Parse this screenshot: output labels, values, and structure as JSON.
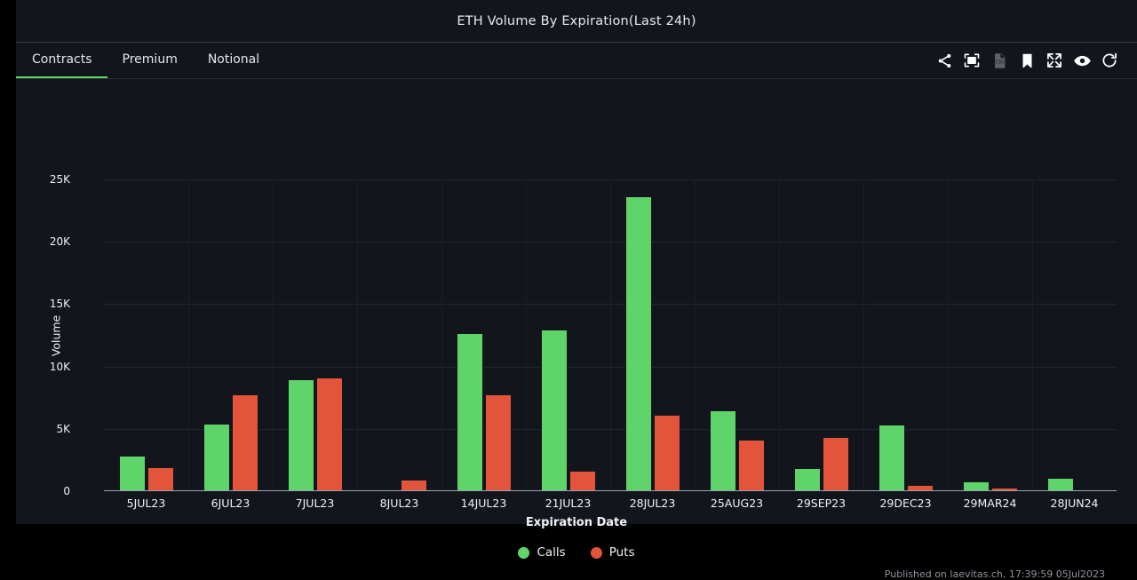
{
  "header": {
    "title": "ETH Volume By Expiration(Last 24h)"
  },
  "tabs": [
    {
      "label": "Contracts",
      "active": true
    },
    {
      "label": "Premium",
      "active": false
    },
    {
      "label": "Notional",
      "active": false
    }
  ],
  "toolbar": [
    {
      "icon": "share-icon",
      "dim": false
    },
    {
      "icon": "save-image-icon",
      "dim": false
    },
    {
      "icon": "csv-file-icon",
      "dim": true
    },
    {
      "icon": "bookmark-icon",
      "dim": false
    },
    {
      "icon": "fullscreen-icon",
      "dim": false
    },
    {
      "icon": "eye-icon",
      "dim": false
    },
    {
      "icon": "refresh-icon",
      "dim": false
    }
  ],
  "footer": {
    "published": "Published on laevitas.ch, 17:39:59 05Jul2023"
  },
  "colors": {
    "calls": "#5ed46a",
    "puts": "#e3543a",
    "panel": "#12161c",
    "page": "#000000",
    "text": "#f0f1f3",
    "grid": "#22272f"
  },
  "chart_data": {
    "type": "bar",
    "title": "ETH Volume By Expiration(Last 24h)",
    "xlabel": "Expiration Date",
    "ylabel": "Volume",
    "ylim": [
      0,
      25000
    ],
    "yticks": [
      0,
      5000,
      10000,
      15000,
      20000,
      25000
    ],
    "ytick_labels": [
      "0",
      "5K",
      "10K",
      "15K",
      "20K",
      "25K"
    ],
    "grid": true,
    "legend_position": "bottom",
    "categories": [
      "5JUL23",
      "6JUL23",
      "7JUL23",
      "8JUL23",
      "14JUL23",
      "21JUL23",
      "28JUL23",
      "25AUG23",
      "29SEP23",
      "29DEC23",
      "29MAR24",
      "28JUN24"
    ],
    "series": [
      {
        "name": "Calls",
        "color": "#5ed46a",
        "values": [
          2850,
          5400,
          8950,
          150,
          12700,
          12950,
          23650,
          6500,
          1850,
          5350,
          750,
          1100
        ]
      },
      {
        "name": "Puts",
        "color": "#e3543a",
        "values": [
          1950,
          7750,
          9100,
          900,
          7750,
          1650,
          6100,
          4100,
          4350,
          500,
          300,
          60
        ]
      }
    ]
  }
}
